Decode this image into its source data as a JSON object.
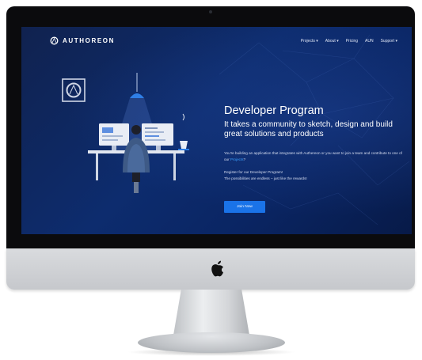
{
  "brand": {
    "name": "AUTHOREON"
  },
  "nav": {
    "items": [
      {
        "label": "Projects ▾"
      },
      {
        "label": "About ▾"
      },
      {
        "label": "Pricing"
      },
      {
        "label": "AUN"
      },
      {
        "label": "Support ▾"
      }
    ]
  },
  "hero": {
    "title": "Developer Program",
    "subtitle": "It takes a community to sketch, design and build great solutions and products",
    "paragraph1_text": "You're building an application that integrates with Authereon or you want to join a team and contribute to one of our",
    "paragraph1_link": "Projects",
    "paragraph1_end": "?",
    "paragraph2_line1": "Register for our Developer Program!",
    "paragraph2_line2": "The possibilities are endless – just like the rewards!",
    "button_label": "Join Now"
  },
  "colors": {
    "screen_bg": "#0d2c6e",
    "accent": "#1a73e8",
    "link": "#3aa0ff",
    "bezel": "#0b0b0d",
    "chin": "#d0d2d5"
  },
  "icons": {
    "brand": "authoreon-logo-icon",
    "device": "apple-logo-icon",
    "illustration": "developer-at-desk-illustration"
  }
}
